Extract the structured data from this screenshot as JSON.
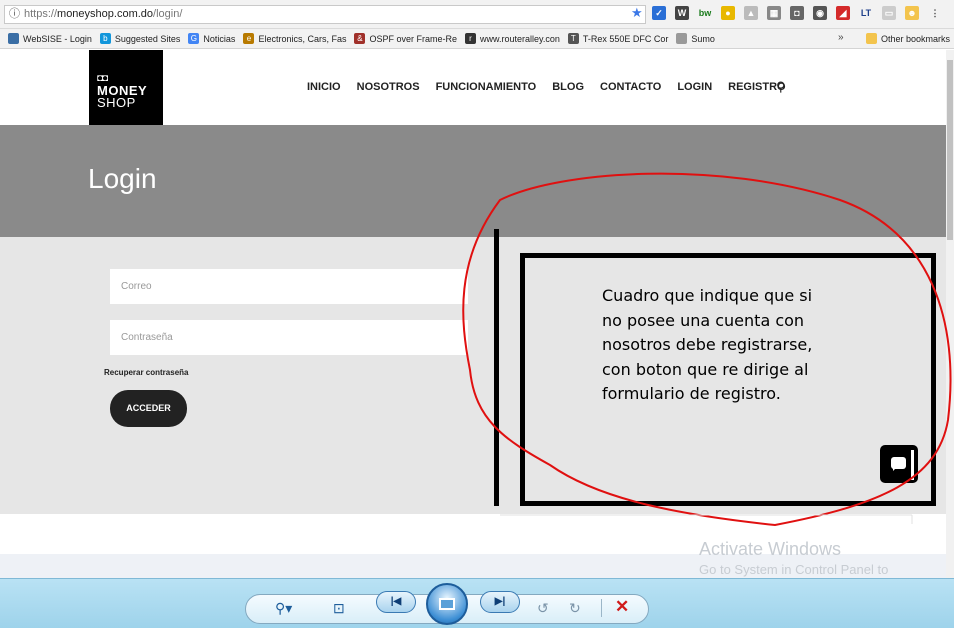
{
  "browser": {
    "url_scheme": "https://",
    "url_domain": "moneyshop.com.do",
    "url_path": "/login/",
    "bookmarks": [
      {
        "label": "WebSISE - Login",
        "color": "#3a6ea5",
        "glyph": ""
      },
      {
        "label": "Suggested Sites",
        "color": "#1296db",
        "glyph": "b"
      },
      {
        "label": "Noticias",
        "color": "#4285f4",
        "glyph": "G"
      },
      {
        "label": "Electronics, Cars, Fas",
        "color": "#b87a00",
        "glyph": "e"
      },
      {
        "label": "OSPF over Frame-Re",
        "color": "#a0302a",
        "glyph": "&"
      },
      {
        "label": "www.routeralley.con",
        "color": "#333333",
        "glyph": "r"
      },
      {
        "label": "T-Rex 550E DFC Cor",
        "color": "#555555",
        "glyph": "T"
      },
      {
        "label": "Sumo",
        "color": "#999999",
        "glyph": ""
      }
    ],
    "more_bookmarks": "»",
    "other_bookmarks": "Other bookmarks"
  },
  "site": {
    "logo_top": "MONEY",
    "logo_bottom": "SHOP",
    "nav": [
      "INICIO",
      "NOSOTROS",
      "FUNCIONAMIENTO",
      "BLOG",
      "CONTACTO",
      "LOGIN",
      "REGISTRO"
    ],
    "hero_title": "Login",
    "email_placeholder": "Correo",
    "password_placeholder": "Contraseña",
    "forgot_password": "Recuperar contraseña",
    "submit_label": "ACCEDER"
  },
  "annotation": {
    "note": "Cuadro que indique que si no posee una cuenta con nosotros debe registrarse, con boton que re dirige al formulario de registro.",
    "circle_color": "#e01010"
  },
  "windows": {
    "activate_title": "Activate Windows",
    "activate_sub": "Go to System in Control Panel to activate Windows."
  },
  "viewer": {
    "zoom_icon": "zoom-icon",
    "actual_size_icon": "actual-size-icon",
    "prev_icon": "previous-icon",
    "slideshow_icon": "slideshow-icon",
    "next_icon": "next-icon",
    "rotate_ccw_icon": "rotate-left-icon",
    "rotate_cw_icon": "rotate-right-icon",
    "delete_icon": "delete-icon"
  }
}
